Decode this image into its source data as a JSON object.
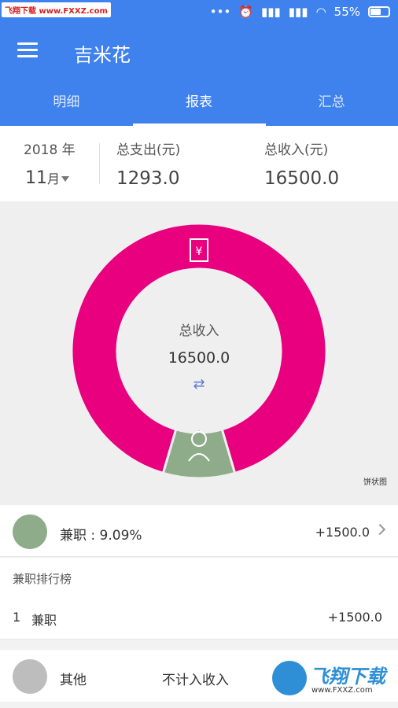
{
  "status_bar": {
    "watermark": "飞翔下载 www.FXXZ.com",
    "battery": "55%"
  },
  "app_bar": {
    "title": "吉米花"
  },
  "tabs": [
    {
      "label": "明细"
    },
    {
      "label": "报表"
    },
    {
      "label": "汇总"
    }
  ],
  "summary": {
    "year": "2018 年",
    "month": "11",
    "month_unit": "月",
    "expense_label": "总支出(元)",
    "expense_value": "1293.0",
    "income_label": "总收入(元)",
    "income_value": "16500.0"
  },
  "chart_data": {
    "type": "pie",
    "categories": [
      "兼职",
      "其他"
    ],
    "values": [
      1500.0,
      15000.0
    ],
    "center_title": "总收入",
    "center_value": "16500.0",
    "colors": [
      "#8fac8a",
      "#e8007f"
    ],
    "chart_label": "饼状图"
  },
  "income_row": {
    "label": "兼职 : 9.09%",
    "amount": "+1500.0"
  },
  "ranking": {
    "title": "兼职排行榜",
    "items": [
      {
        "rank": "1",
        "name": "兼职",
        "amount": "+1500.0"
      }
    ]
  },
  "other_row": {
    "label": "其他",
    "note": "不计入收入"
  },
  "watermark_bottom": {
    "brand": "飞翔下载",
    "url": "www.FXXZ.com"
  }
}
